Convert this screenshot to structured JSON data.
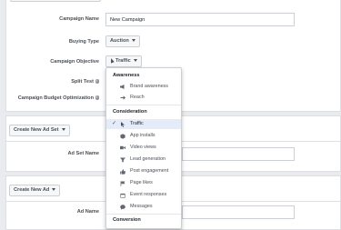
{
  "campaign": {
    "name_label": "Campaign Name",
    "name_value": "New Campaign",
    "buying_type_label": "Buying Type",
    "buying_type_value": "Auction",
    "objective_label": "Campaign Objective",
    "objective_value": "Traffic",
    "split_test_label": "Split Test",
    "budget_opt_label": "Campaign Budget Optimization",
    "info_glyph": "i"
  },
  "ad_set": {
    "create_button": "Create New Ad Set",
    "name_label": "Ad Set Name"
  },
  "ad": {
    "create_button": "Create New Ad",
    "name_label": "Ad Name"
  },
  "objective_menu": {
    "groups": [
      {
        "header": "Awareness",
        "items": [
          {
            "label": "Brand awareness",
            "icon": "megaphone-icon"
          },
          {
            "label": "Reach",
            "icon": "reach-icon"
          }
        ]
      },
      {
        "header": "Consideration",
        "items": [
          {
            "label": "Traffic",
            "icon": "cursor-icon",
            "selected": true
          },
          {
            "label": "App installs",
            "icon": "box-icon"
          },
          {
            "label": "Video views",
            "icon": "video-icon"
          },
          {
            "label": "Lead generation",
            "icon": "funnel-icon"
          },
          {
            "label": "Post engagement",
            "icon": "thumbs-up-icon"
          },
          {
            "label": "Page likes",
            "icon": "flag-icon"
          },
          {
            "label": "Event responses",
            "icon": "calendar-icon"
          },
          {
            "label": "Messages",
            "icon": "chat-icon"
          }
        ]
      },
      {
        "header": "Conversion",
        "items": []
      }
    ]
  },
  "colors": {
    "background": "#e9ebee",
    "selected_row": "#e4ecfa",
    "border": "#ccd0d5"
  }
}
